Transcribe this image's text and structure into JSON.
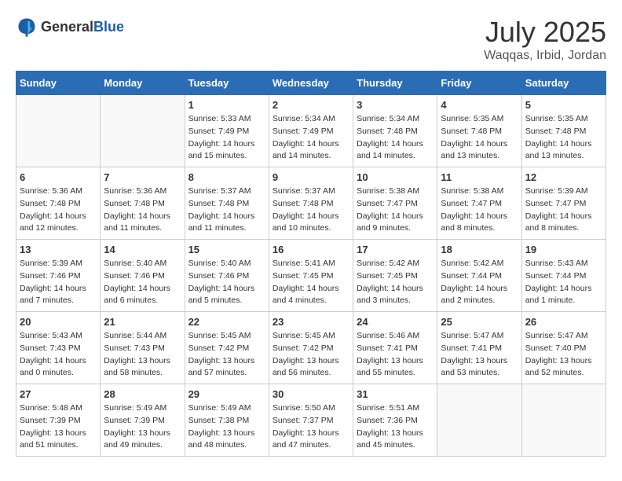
{
  "logo": {
    "general": "General",
    "blue": "Blue"
  },
  "header": {
    "month": "July 2025",
    "location": "Waqqas, Irbid, Jordan"
  },
  "days_of_week": [
    "Sunday",
    "Monday",
    "Tuesday",
    "Wednesday",
    "Thursday",
    "Friday",
    "Saturday"
  ],
  "weeks": [
    [
      {
        "day": "",
        "content": ""
      },
      {
        "day": "",
        "content": ""
      },
      {
        "day": "1",
        "content": "Sunrise: 5:33 AM\nSunset: 7:49 PM\nDaylight: 14 hours and 15 minutes."
      },
      {
        "day": "2",
        "content": "Sunrise: 5:34 AM\nSunset: 7:49 PM\nDaylight: 14 hours and 14 minutes."
      },
      {
        "day": "3",
        "content": "Sunrise: 5:34 AM\nSunset: 7:48 PM\nDaylight: 14 hours and 14 minutes."
      },
      {
        "day": "4",
        "content": "Sunrise: 5:35 AM\nSunset: 7:48 PM\nDaylight: 14 hours and 13 minutes."
      },
      {
        "day": "5",
        "content": "Sunrise: 5:35 AM\nSunset: 7:48 PM\nDaylight: 14 hours and 13 minutes."
      }
    ],
    [
      {
        "day": "6",
        "content": "Sunrise: 5:36 AM\nSunset: 7:48 PM\nDaylight: 14 hours and 12 minutes."
      },
      {
        "day": "7",
        "content": "Sunrise: 5:36 AM\nSunset: 7:48 PM\nDaylight: 14 hours and 11 minutes."
      },
      {
        "day": "8",
        "content": "Sunrise: 5:37 AM\nSunset: 7:48 PM\nDaylight: 14 hours and 11 minutes."
      },
      {
        "day": "9",
        "content": "Sunrise: 5:37 AM\nSunset: 7:48 PM\nDaylight: 14 hours and 10 minutes."
      },
      {
        "day": "10",
        "content": "Sunrise: 5:38 AM\nSunset: 7:47 PM\nDaylight: 14 hours and 9 minutes."
      },
      {
        "day": "11",
        "content": "Sunrise: 5:38 AM\nSunset: 7:47 PM\nDaylight: 14 hours and 8 minutes."
      },
      {
        "day": "12",
        "content": "Sunrise: 5:39 AM\nSunset: 7:47 PM\nDaylight: 14 hours and 8 minutes."
      }
    ],
    [
      {
        "day": "13",
        "content": "Sunrise: 5:39 AM\nSunset: 7:46 PM\nDaylight: 14 hours and 7 minutes."
      },
      {
        "day": "14",
        "content": "Sunrise: 5:40 AM\nSunset: 7:46 PM\nDaylight: 14 hours and 6 minutes."
      },
      {
        "day": "15",
        "content": "Sunrise: 5:40 AM\nSunset: 7:46 PM\nDaylight: 14 hours and 5 minutes."
      },
      {
        "day": "16",
        "content": "Sunrise: 5:41 AM\nSunset: 7:45 PM\nDaylight: 14 hours and 4 minutes."
      },
      {
        "day": "17",
        "content": "Sunrise: 5:42 AM\nSunset: 7:45 PM\nDaylight: 14 hours and 3 minutes."
      },
      {
        "day": "18",
        "content": "Sunrise: 5:42 AM\nSunset: 7:44 PM\nDaylight: 14 hours and 2 minutes."
      },
      {
        "day": "19",
        "content": "Sunrise: 5:43 AM\nSunset: 7:44 PM\nDaylight: 14 hours and 1 minute."
      }
    ],
    [
      {
        "day": "20",
        "content": "Sunrise: 5:43 AM\nSunset: 7:43 PM\nDaylight: 14 hours and 0 minutes."
      },
      {
        "day": "21",
        "content": "Sunrise: 5:44 AM\nSunset: 7:43 PM\nDaylight: 13 hours and 58 minutes."
      },
      {
        "day": "22",
        "content": "Sunrise: 5:45 AM\nSunset: 7:42 PM\nDaylight: 13 hours and 57 minutes."
      },
      {
        "day": "23",
        "content": "Sunrise: 5:45 AM\nSunset: 7:42 PM\nDaylight: 13 hours and 56 minutes."
      },
      {
        "day": "24",
        "content": "Sunrise: 5:46 AM\nSunset: 7:41 PM\nDaylight: 13 hours and 55 minutes."
      },
      {
        "day": "25",
        "content": "Sunrise: 5:47 AM\nSunset: 7:41 PM\nDaylight: 13 hours and 53 minutes."
      },
      {
        "day": "26",
        "content": "Sunrise: 5:47 AM\nSunset: 7:40 PM\nDaylight: 13 hours and 52 minutes."
      }
    ],
    [
      {
        "day": "27",
        "content": "Sunrise: 5:48 AM\nSunset: 7:39 PM\nDaylight: 13 hours and 51 minutes."
      },
      {
        "day": "28",
        "content": "Sunrise: 5:49 AM\nSunset: 7:39 PM\nDaylight: 13 hours and 49 minutes."
      },
      {
        "day": "29",
        "content": "Sunrise: 5:49 AM\nSunset: 7:38 PM\nDaylight: 13 hours and 48 minutes."
      },
      {
        "day": "30",
        "content": "Sunrise: 5:50 AM\nSunset: 7:37 PM\nDaylight: 13 hours and 47 minutes."
      },
      {
        "day": "31",
        "content": "Sunrise: 5:51 AM\nSunset: 7:36 PM\nDaylight: 13 hours and 45 minutes."
      },
      {
        "day": "",
        "content": ""
      },
      {
        "day": "",
        "content": ""
      }
    ]
  ]
}
